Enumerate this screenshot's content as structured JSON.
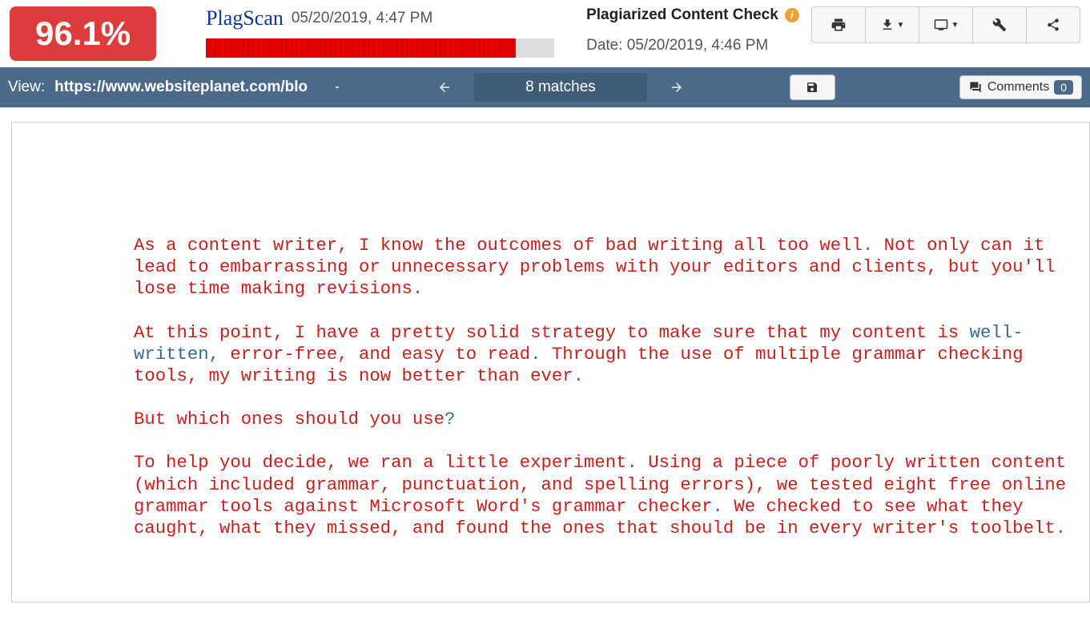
{
  "header": {
    "percentage": "96.1%",
    "logo": "PlagScan",
    "timestamp": "05/20/2019, 4:47 PM",
    "doc_title": "Plagiarized Content Check",
    "date_label": "Date: 05/20/2019, 4:46 PM",
    "progress_pct": 89
  },
  "nav": {
    "view_label": "View:",
    "url": "https://www.websiteplanet.com/blo",
    "matches": "8 matches",
    "comments_label": "Comments",
    "comments_count": "0"
  },
  "content": {
    "paragraphs": [
      {
        "segments": [
          {
            "t": "As a content writer, I know the outcomes of bad writing all too well",
            "c": "red"
          },
          {
            "t": ".",
            "c": "neutral"
          },
          {
            "t": " Not only can it lead to embarrassing or unnecessary problems with your editors and clients, but you'll lose time making revisions",
            "c": "red"
          },
          {
            "t": ".",
            "c": "neutral"
          }
        ]
      },
      {
        "segments": [
          {
            "t": "At this point, I have a pretty solid strategy to make sure that my content is ",
            "c": "red"
          },
          {
            "t": "well-written,",
            "c": "neutral"
          },
          {
            "t": " error-free, and easy to read",
            "c": "red"
          },
          {
            "t": ".",
            "c": "neutral"
          },
          {
            "t": " Through the use of multiple grammar checking tools, my writing is now better than ever",
            "c": "red"
          },
          {
            "t": ".",
            "c": "neutral"
          }
        ]
      },
      {
        "segments": [
          {
            "t": "But which ones should you use",
            "c": "red"
          },
          {
            "t": "?",
            "c": "neutral"
          }
        ]
      },
      {
        "segments": [
          {
            "t": "To help you decide, we ran a little experiment",
            "c": "red"
          },
          {
            "t": ".",
            "c": "neutral"
          },
          {
            "t": " Using a piece of poorly written content (which included grammar, punctuation, and spelling errors), we tested eight free online grammar tools against Microsoft Word's grammar checker",
            "c": "red"
          },
          {
            "t": ".",
            "c": "neutral"
          },
          {
            "t": " We checked to see what they caught, what they missed, and found the ones that should be in every writer's toolbelt",
            "c": "red"
          },
          {
            "t": ".",
            "c": "neutral"
          }
        ]
      }
    ]
  }
}
